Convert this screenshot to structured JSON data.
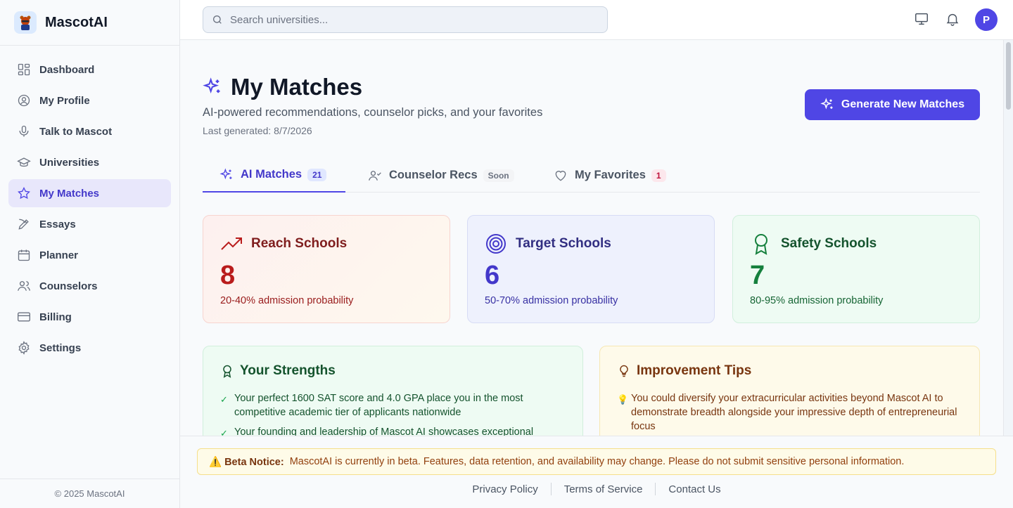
{
  "brand": {
    "name": "MascotAI"
  },
  "search": {
    "placeholder": "Search universities..."
  },
  "sidebar": {
    "items": [
      {
        "label": "Dashboard",
        "icon": "dashboard-icon"
      },
      {
        "label": "My Profile",
        "icon": "user-circle-icon"
      },
      {
        "label": "Talk to Mascot",
        "icon": "microphone-icon"
      },
      {
        "label": "Universities",
        "icon": "graduation-cap-icon"
      },
      {
        "label": "My Matches",
        "icon": "star-icon",
        "active": true
      },
      {
        "label": "Essays",
        "icon": "pen-tool-icon"
      },
      {
        "label": "Planner",
        "icon": "calendar-icon"
      },
      {
        "label": "Counselors",
        "icon": "users-icon"
      },
      {
        "label": "Billing",
        "icon": "credit-card-icon"
      },
      {
        "label": "Settings",
        "icon": "gear-icon"
      }
    ],
    "footer": "© 2025 MascotAI"
  },
  "user": {
    "initial": "P"
  },
  "page": {
    "title": "My Matches",
    "subtitle": "AI-powered recommendations, counselor picks, and your favorites",
    "last_generated": "Last generated: 8/7/2026",
    "generate_label": "Generate New Matches"
  },
  "tabs": [
    {
      "label": "AI Matches",
      "badge": "21",
      "active": true
    },
    {
      "label": "Counselor Recs",
      "badge": "Soon"
    },
    {
      "label": "My Favorites",
      "badge": "1"
    }
  ],
  "stats": {
    "reach": {
      "title": "Reach Schools",
      "count": "8",
      "probability": "20-40% admission probability",
      "color": "#b91c1c"
    },
    "target": {
      "title": "Target Schools",
      "count": "6",
      "probability": "50-70% admission probability",
      "color": "#4338ca"
    },
    "safety": {
      "title": "Safety Schools",
      "count": "7",
      "probability": "80-95% admission probability",
      "color": "#15803d"
    }
  },
  "strengths": {
    "title": "Your Strengths",
    "items": [
      "Your perfect 1600 SAT score and 4.0 GPA place you in the most competitive academic tier of applicants nationwide",
      "Your founding and leadership of Mascot AI showcases exceptional"
    ]
  },
  "tips": {
    "title": "Improvement Tips",
    "items": [
      "You could diversify your extracurricular activities beyond Mascot AI to demonstrate breadth alongside your impressive depth of entrepreneurial focus"
    ]
  },
  "footer": {
    "beta_label": "⚠️ Beta Notice:",
    "beta_text": "MascotAI is currently in beta. Features, data retention, and availability may change. Please do not submit sensitive personal information.",
    "links": [
      "Privacy Policy",
      "Terms of Service",
      "Contact Us"
    ]
  },
  "colors": {
    "accent": "#4f46e5",
    "active_bg": "#e8e7fb"
  }
}
